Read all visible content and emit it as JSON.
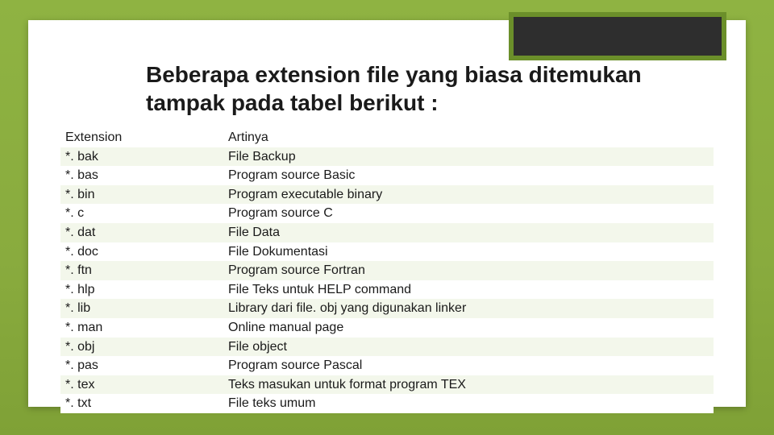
{
  "title": "Beberapa extension file yang biasa ditemukan tampak pada tabel berikut :",
  "headers": {
    "ext": "Extension",
    "meaning": "Artinya"
  },
  "rows": [
    {
      "ext": "*. bak",
      "meaning": "File Backup"
    },
    {
      "ext": "*. bas",
      "meaning": "Program source Basic"
    },
    {
      "ext": "*. bin",
      "meaning": "Program executable binary"
    },
    {
      "ext": "*. c",
      "meaning": "Program source C"
    },
    {
      "ext": "*. dat",
      "meaning": "File Data"
    },
    {
      "ext": "*. doc",
      "meaning": "File Dokumentasi"
    },
    {
      "ext": "*. ftn",
      "meaning": "Program source Fortran"
    },
    {
      "ext": "*. hlp",
      "meaning": "File Teks untuk HELP command"
    },
    {
      "ext": "*. lib",
      "meaning": "Library dari file. obj yang digunakan linker"
    },
    {
      "ext": "*. man",
      "meaning": "Online manual page"
    },
    {
      "ext": "*. obj",
      "meaning": "File object"
    },
    {
      "ext": "*. pas",
      "meaning": "Program source Pascal"
    },
    {
      "ext": "*. tex",
      "meaning": "Teks masukan untuk format program TEX"
    },
    {
      "ext": "*. txt",
      "meaning": "File teks umum"
    }
  ]
}
